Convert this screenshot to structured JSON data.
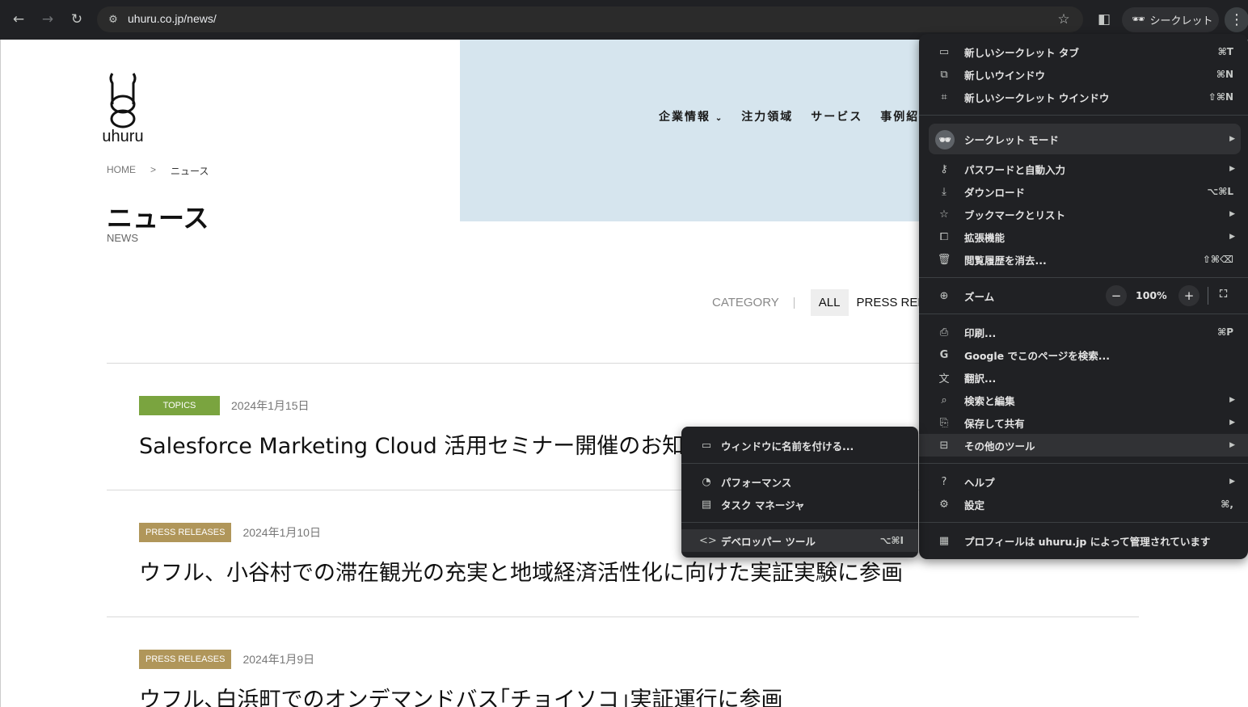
{
  "browser": {
    "url": "uhuru.co.jp/news/",
    "incognito_label": "シークレット",
    "icons": {
      "back": "arrow-left-icon",
      "forward": "arrow-right-icon",
      "reload": "reload-icon",
      "site_info": "tune-icon",
      "bookmark": "star-icon",
      "side_panel": "side-panel-icon",
      "incognito": "incognito-icon",
      "menu": "kebab-icon"
    }
  },
  "site": {
    "logo_text": "uhuru",
    "nav": [
      "企業情報",
      "注力領域",
      "サービス",
      "事例紹"
    ],
    "breadcrumb": {
      "home": "HOME",
      "sep": ">",
      "current": "ニュース"
    },
    "title": "ニュース",
    "subtitle": "NEWS",
    "category_label": "CATEGORY",
    "category_all": "ALL",
    "category_press": "PRESS RELE",
    "news": [
      {
        "tag": "TOPICS",
        "tag_color": "#7aa43f",
        "date": "2024年1月15日",
        "title": "Salesforce Marketing Cloud 活用セミナー開催のお知"
      },
      {
        "tag": "PRESS RELEASES",
        "tag_color": "#b0965a",
        "date": "2024年1月10日",
        "title": "ウフル、小谷村での滞在観光の充実と地域経済活性化に向けた実証実験に参画"
      },
      {
        "tag": "PRESS RELEASES",
        "tag_color": "#b0965a",
        "date": "2024年1月9日",
        "title": "ウフル､白浜町でのオンデマンドバス｢チョイソコ｣実証運行に参画"
      }
    ]
  },
  "menu": {
    "items": [
      {
        "id": "new-incognito-tab",
        "icon": "tab-icon",
        "label": "新しいシークレット タブ",
        "shortcut": "⌘T"
      },
      {
        "id": "new-window",
        "icon": "new-window-icon",
        "label": "新しいウインドウ",
        "shortcut": "⌘N"
      },
      {
        "id": "new-incognito-window",
        "icon": "incognito-icon",
        "label": "新しいシークレット ウインドウ",
        "shortcut": "⇧⌘N"
      },
      {
        "id": "incognito-mode",
        "icon": "incognito-icon",
        "label": "シークレット モード",
        "submenu": true
      },
      {
        "id": "passwords",
        "icon": "key-icon",
        "label": "パスワードと自動入力",
        "submenu": true
      },
      {
        "id": "downloads",
        "icon": "download-icon",
        "label": "ダウンロード",
        "shortcut": "⌥⌘L"
      },
      {
        "id": "bookmarks",
        "icon": "star-icon",
        "label": "ブックマークとリスト",
        "submenu": true
      },
      {
        "id": "extensions",
        "icon": "puzzle-icon",
        "label": "拡張機能",
        "submenu": true
      },
      {
        "id": "clear-history",
        "icon": "trash-icon",
        "label": "閲覧履歴を消去...",
        "shortcut": "⇧⌘⌫"
      },
      {
        "id": "zoom",
        "icon": "zoom-icon",
        "label": "ズーム",
        "zoom_value": "100%"
      },
      {
        "id": "print",
        "icon": "print-icon",
        "label": "印刷...",
        "shortcut": "⌘P"
      },
      {
        "id": "google-search",
        "icon": "google-icon",
        "label": "Google でこのページを検索..."
      },
      {
        "id": "translate",
        "icon": "translate-icon",
        "label": "翻訳..."
      },
      {
        "id": "find-edit",
        "icon": "find-icon",
        "label": "検索と編集",
        "submenu": true
      },
      {
        "id": "save-share",
        "icon": "save-icon",
        "label": "保存して共有",
        "submenu": true
      },
      {
        "id": "more-tools",
        "icon": "toolbox-icon",
        "label": "その他のツール",
        "submenu": true
      },
      {
        "id": "help",
        "icon": "help-icon",
        "label": "ヘルプ",
        "submenu": true
      },
      {
        "id": "settings",
        "icon": "gear-icon",
        "label": "設定",
        "shortcut": "⌘,"
      },
      {
        "id": "managed",
        "icon": "building-icon",
        "label": "プロフィールは uhuru.jp によって管理されています"
      }
    ],
    "zoom_minus": "−",
    "zoom_plus": "+"
  },
  "submenu": {
    "items": [
      {
        "id": "name-window",
        "icon": "window-icon",
        "label": "ウィンドウに名前を付ける..."
      },
      {
        "id": "performance",
        "icon": "gauge-icon",
        "label": "パフォーマンス"
      },
      {
        "id": "task-manager",
        "icon": "task-manager-icon",
        "label": "タスク マネージャ"
      },
      {
        "id": "developer-tools",
        "icon": "code-icon",
        "label": "デベロッパー ツール",
        "shortcut": "⌥⌘I"
      }
    ]
  }
}
